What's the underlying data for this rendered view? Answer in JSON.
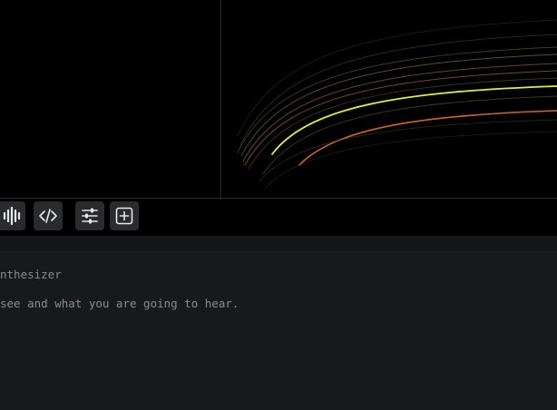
{
  "toolbar": {
    "buttons": [
      {
        "name": "waveform-button",
        "icon": "waveform-icon"
      },
      {
        "name": "code-button",
        "icon": "code-icon"
      },
      {
        "name": "settings-button",
        "icon": "sliders-icon"
      },
      {
        "name": "add-button",
        "icon": "plus-square-icon"
      }
    ]
  },
  "content": {
    "line1": "nthesizer",
    "line2": "see and what you are going to hear."
  },
  "colors": {
    "background": "#000000",
    "panel": "#17191a",
    "button": "#2a2b2c",
    "text": "#8a8d8f",
    "curve_highlight_yellow": "#e8f020",
    "curve_highlight_orange": "#e06a20",
    "curve_dim": "#5a5a10"
  }
}
